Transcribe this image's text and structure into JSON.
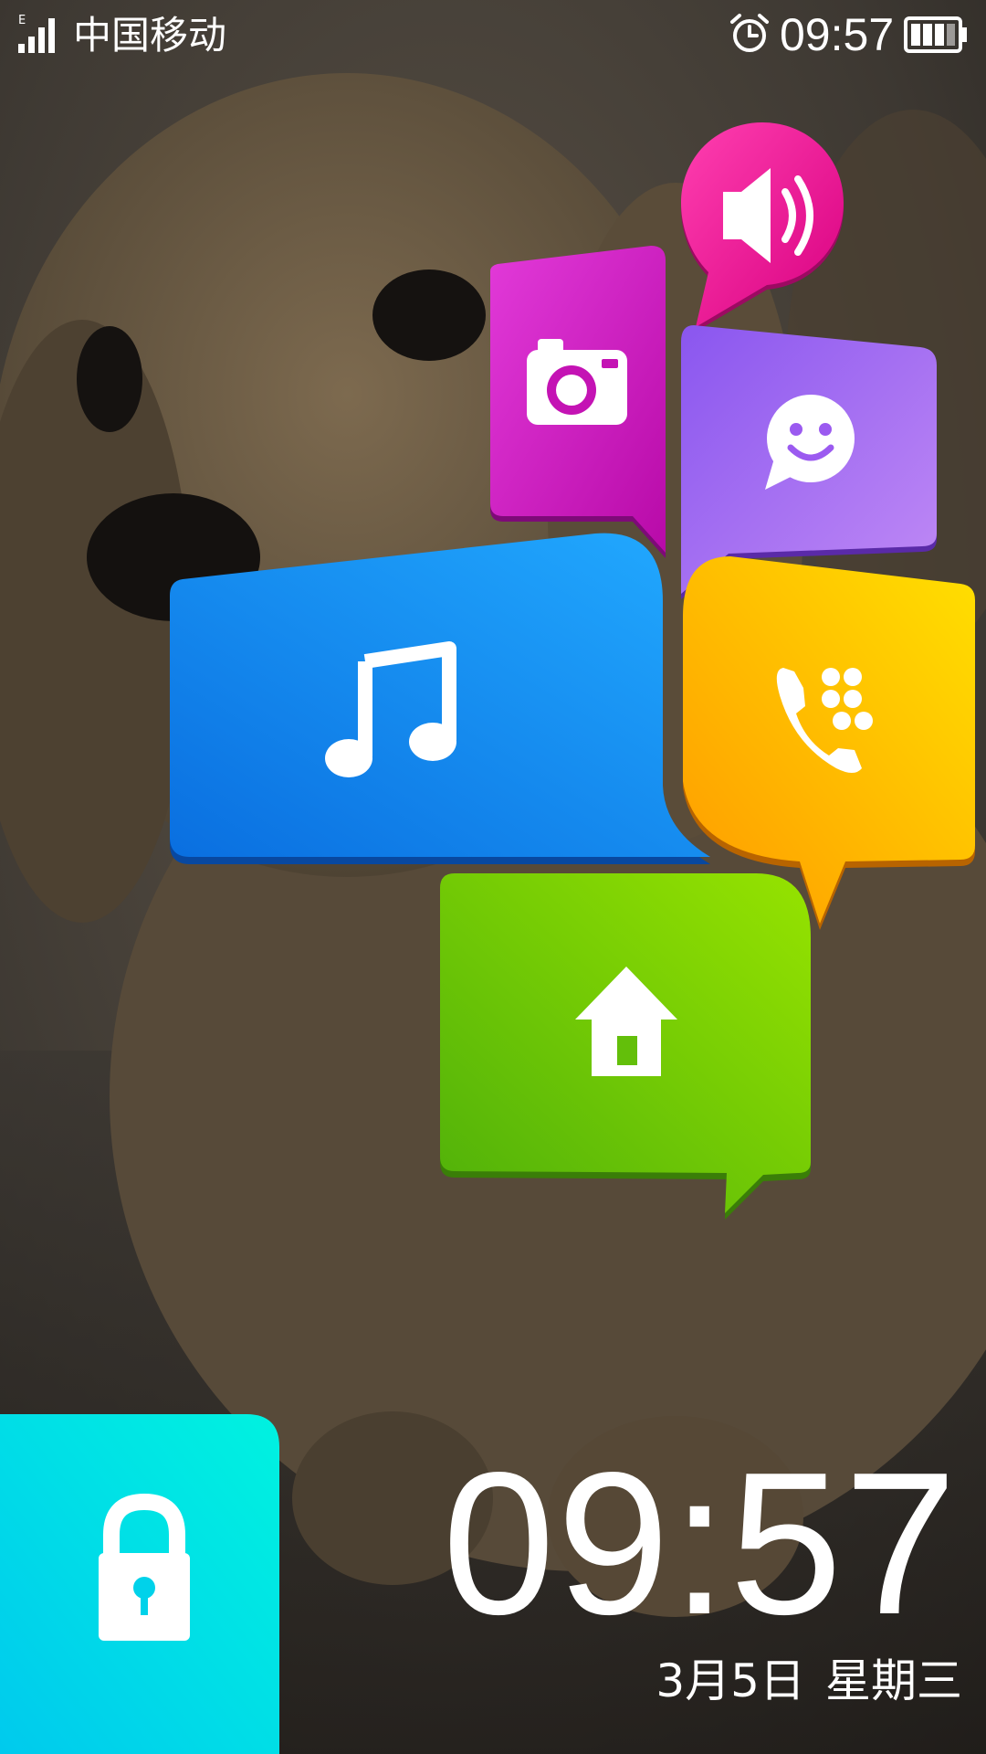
{
  "status_bar": {
    "carrier": "中国移动",
    "network_type": "E",
    "time": "09:57",
    "icons": [
      "signal-icon",
      "alarm-icon",
      "battery-icon"
    ]
  },
  "tiles": [
    {
      "name": "volume",
      "icon": "speaker-icon",
      "color": "#e6148a"
    },
    {
      "name": "camera",
      "icon": "camera-icon",
      "color": "#c813b8"
    },
    {
      "name": "messaging",
      "icon": "chat-smiley-icon",
      "color": "#9b5af0"
    },
    {
      "name": "music",
      "icon": "music-note-icon",
      "color": "#1a8ff0"
    },
    {
      "name": "dialer",
      "icon": "phone-dialpad-icon",
      "color": "#ffc000"
    },
    {
      "name": "home",
      "icon": "home-icon",
      "color": "#6cc60a"
    },
    {
      "name": "unlock",
      "icon": "lock-icon",
      "color": "#00d8f0"
    }
  ],
  "clock": {
    "time": "09:57",
    "date": "3月5日",
    "weekday": "星期三"
  }
}
